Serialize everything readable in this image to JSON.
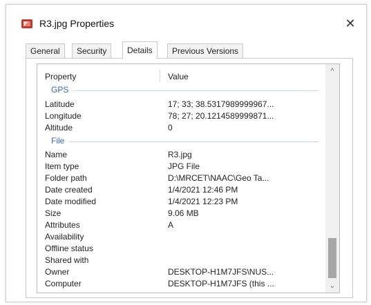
{
  "window": {
    "title": "R3.jpg Properties",
    "close_glyph": "✕",
    "icon": "jpg-file-icon"
  },
  "tabs": [
    {
      "label": "General",
      "active": false
    },
    {
      "label": "Security",
      "active": false
    },
    {
      "label": "Details",
      "active": true
    },
    {
      "label": "Previous Versions",
      "active": false
    }
  ],
  "details": {
    "column_headers": {
      "property": "Property",
      "value": "Value"
    },
    "groups": [
      {
        "name": "GPS",
        "rows": [
          {
            "property": "Latitude",
            "value": "17; 33; 38.5317989999967..."
          },
          {
            "property": "Longitude",
            "value": "78; 27; 20.1214589999871..."
          },
          {
            "property": "Altitude",
            "value": "0"
          }
        ]
      },
      {
        "name": "File",
        "rows": [
          {
            "property": "Name",
            "value": "R3.jpg"
          },
          {
            "property": "Item type",
            "value": "JPG File"
          },
          {
            "property": "Folder path",
            "value": "D:\\MRCET\\NAAC\\Geo Ta..."
          },
          {
            "property": "Date created",
            "value": "1/4/2021 12:46 PM"
          },
          {
            "property": "Date modified",
            "value": "1/4/2021 12:23 PM"
          },
          {
            "property": "Size",
            "value": "9.06 MB"
          },
          {
            "property": "Attributes",
            "value": "A"
          },
          {
            "property": "Availability",
            "value": ""
          },
          {
            "property": "Offline status",
            "value": ""
          },
          {
            "property": "Shared with",
            "value": ""
          },
          {
            "property": "Owner",
            "value": "DESKTOP-H1M7JFS\\NUS..."
          },
          {
            "property": "Computer",
            "value": "DESKTOP-H1M7JFS (this ..."
          }
        ]
      }
    ]
  },
  "scrollbar": {
    "up_glyph": "^",
    "down_glyph": "⌄"
  },
  "colors": {
    "group_header": "#3a63b8",
    "scroll_thumb": "#a6a6a6"
  }
}
